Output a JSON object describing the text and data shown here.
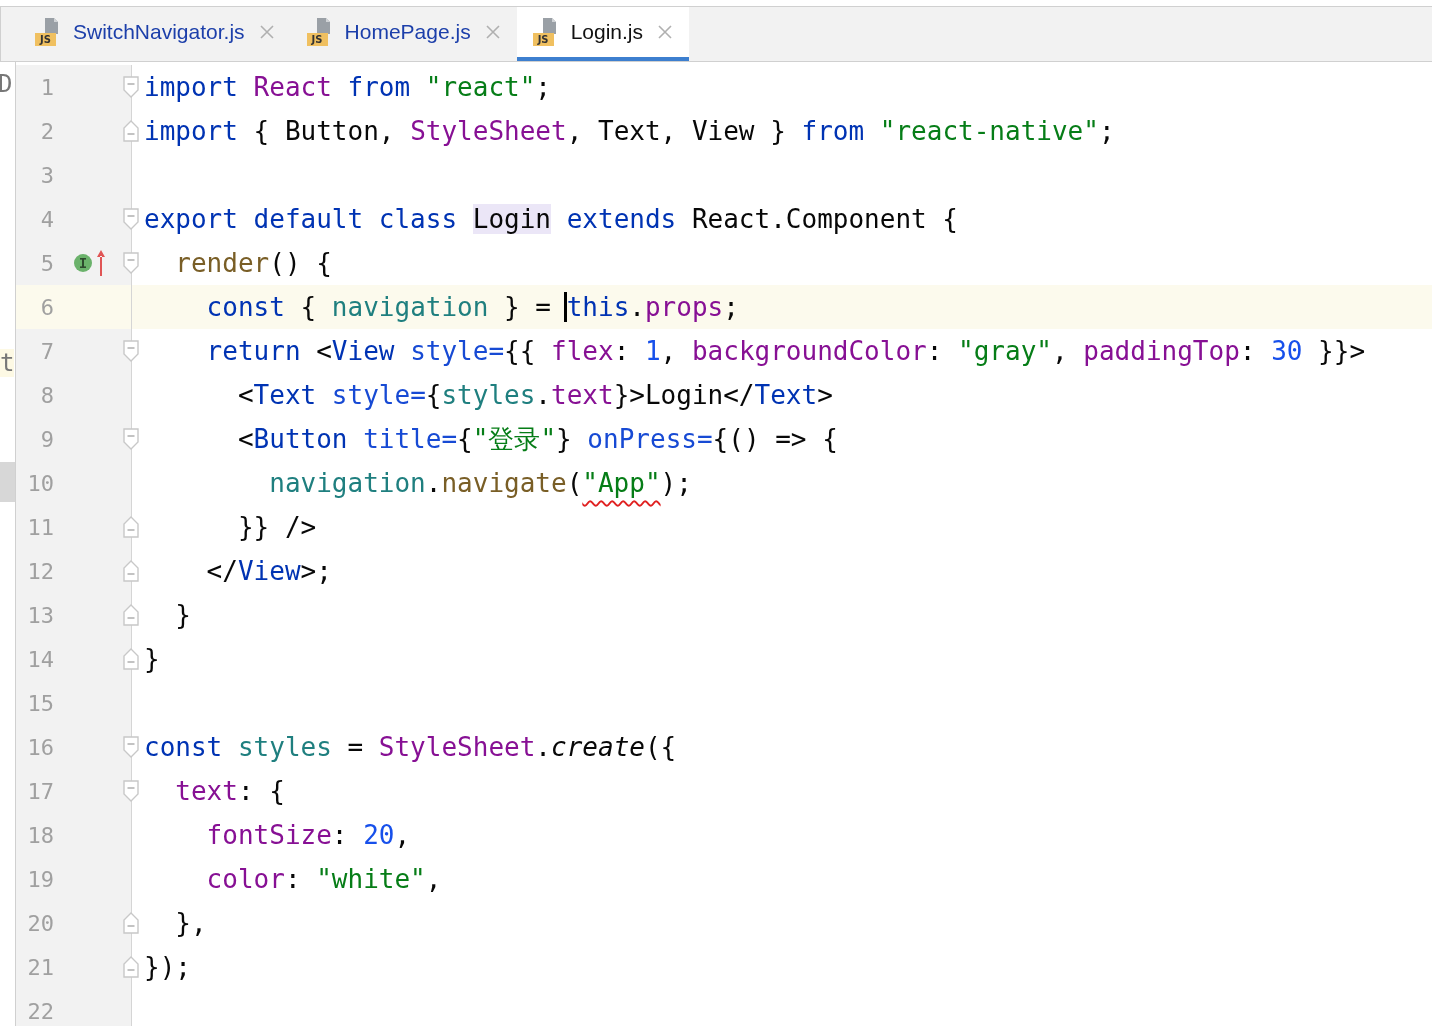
{
  "side_fragments": [
    {
      "text": "D"
    },
    {
      "text": "t"
    }
  ],
  "tabs": [
    {
      "label": "SwitchNavigator.js",
      "icon_text": "JS",
      "selected": false
    },
    {
      "label": "HomePage.js",
      "icon_text": "JS",
      "selected": false
    },
    {
      "label": "Login.js",
      "icon_text": "JS",
      "selected": true
    }
  ],
  "lines": [
    {
      "number": "1",
      "fold_open": true,
      "tokens": [
        {
          "text": "import ",
          "kind": "kw"
        },
        {
          "text": "React ",
          "kind": "cls"
        },
        {
          "text": "from ",
          "kind": "kw"
        },
        {
          "text": "\"react\"",
          "kind": "str"
        },
        {
          "text": ";",
          "kind": "p"
        }
      ]
    },
    {
      "number": "2",
      "fold_close": true,
      "tokens": [
        {
          "text": "import ",
          "kind": "kw"
        },
        {
          "text": "{ Button, ",
          "kind": "p"
        },
        {
          "text": "StyleSheet",
          "kind": "cls"
        },
        {
          "text": ", Text, View } ",
          "kind": "p"
        },
        {
          "text": "from ",
          "kind": "kw"
        },
        {
          "text": "\"react-native\"",
          "kind": "str"
        },
        {
          "text": ";",
          "kind": "p"
        }
      ]
    },
    {
      "number": "3"
    },
    {
      "number": "4",
      "fold_open": true,
      "tokens": [
        {
          "text": "export default class ",
          "kind": "kw"
        },
        {
          "text": "Login",
          "kind": "hl"
        },
        {
          "text": " extends ",
          "kind": "kw"
        },
        {
          "text": "React.Component {",
          "kind": "p"
        }
      ]
    },
    {
      "number": "5",
      "fold_open": true,
      "markers": [
        {
          "kind": "implements"
        },
        {
          "kind": "overrides"
        }
      ],
      "tokens": [
        {
          "text": "  render",
          "kind": "fn"
        },
        {
          "text": "() {",
          "kind": "p"
        }
      ]
    },
    {
      "number": "6",
      "current": true,
      "tokens": [
        {
          "text": "    const ",
          "kind": "kw"
        },
        {
          "text": "{ ",
          "kind": "p"
        },
        {
          "text": "navigation ",
          "kind": "var"
        },
        {
          "text": "} = ",
          "kind": "p"
        },
        {
          "text": "this",
          "kind": "kw",
          "caret": true
        },
        {
          "text": ".",
          "kind": "p"
        },
        {
          "text": "props",
          "kind": "prop"
        },
        {
          "text": ";",
          "kind": "p"
        }
      ]
    },
    {
      "number": "7",
      "fold_open": true,
      "tokens": [
        {
          "text": "    return ",
          "kind": "kw"
        },
        {
          "text": "<",
          "kind": "p"
        },
        {
          "text": "View ",
          "kind": "tag"
        },
        {
          "text": "style=",
          "kind": "attr"
        },
        {
          "text": "{{ ",
          "kind": "p"
        },
        {
          "text": "flex",
          "kind": "prop"
        },
        {
          "text": ": ",
          "kind": "p"
        },
        {
          "text": "1",
          "kind": "num"
        },
        {
          "text": ", ",
          "kind": "p"
        },
        {
          "text": "backgroundColor",
          "kind": "prop"
        },
        {
          "text": ": ",
          "kind": "p"
        },
        {
          "text": "\"gray\"",
          "kind": "str"
        },
        {
          "text": ", ",
          "kind": "p"
        },
        {
          "text": "paddingTop",
          "kind": "prop"
        },
        {
          "text": ": ",
          "kind": "p"
        },
        {
          "text": "30",
          "kind": "num"
        },
        {
          "text": " }}>",
          "kind": "p"
        }
      ]
    },
    {
      "number": "8",
      "tokens": [
        {
          "text": "      <",
          "kind": "p"
        },
        {
          "text": "Text ",
          "kind": "tag"
        },
        {
          "text": "style=",
          "kind": "attr"
        },
        {
          "text": "{",
          "kind": "p"
        },
        {
          "text": "styles",
          "kind": "var"
        },
        {
          "text": ".",
          "kind": "p"
        },
        {
          "text": "text",
          "kind": "prop"
        },
        {
          "text": "}>Login</",
          "kind": "p"
        },
        {
          "text": "Text",
          "kind": "tag"
        },
        {
          "text": ">",
          "kind": "p"
        }
      ]
    },
    {
      "number": "9",
      "fold_open": true,
      "tokens": [
        {
          "text": "      <",
          "kind": "p"
        },
        {
          "text": "Button ",
          "kind": "tag"
        },
        {
          "text": "title=",
          "kind": "attr"
        },
        {
          "text": "{",
          "kind": "p"
        },
        {
          "text": "\"登录\"",
          "kind": "str"
        },
        {
          "text": "} ",
          "kind": "p"
        },
        {
          "text": "onPress=",
          "kind": "attr"
        },
        {
          "text": "{() => {",
          "kind": "p"
        }
      ]
    },
    {
      "number": "10",
      "tokens": [
        {
          "text": "        navigation",
          "kind": "var"
        },
        {
          "text": ".",
          "kind": "p"
        },
        {
          "text": "navigate",
          "kind": "fn"
        },
        {
          "text": "(",
          "kind": "p"
        },
        {
          "text": "\"App\"",
          "kind": "str",
          "underline": true
        },
        {
          "text": ");",
          "kind": "p"
        }
      ]
    },
    {
      "number": "11",
      "fold_close": true,
      "tokens": [
        {
          "text": "      }} />",
          "kind": "p"
        }
      ]
    },
    {
      "number": "12",
      "fold_close": true,
      "tokens": [
        {
          "text": "    </",
          "kind": "p"
        },
        {
          "text": "View",
          "kind": "tag"
        },
        {
          "text": ">;",
          "kind": "p"
        }
      ]
    },
    {
      "number": "13",
      "fold_close": true,
      "tokens": [
        {
          "text": "  }",
          "kind": "p"
        }
      ]
    },
    {
      "number": "14",
      "fold_close": true,
      "tokens": [
        {
          "text": "}",
          "kind": "p"
        }
      ]
    },
    {
      "number": "15"
    },
    {
      "number": "16",
      "fold_open": true,
      "tokens": [
        {
          "text": "const ",
          "kind": "kw"
        },
        {
          "text": "styles ",
          "kind": "var"
        },
        {
          "text": "= ",
          "kind": "p"
        },
        {
          "text": "StyleSheet",
          "kind": "cls"
        },
        {
          "text": ".",
          "kind": "p"
        },
        {
          "text": "create",
          "kind": "it"
        },
        {
          "text": "({",
          "kind": "p"
        }
      ]
    },
    {
      "number": "17",
      "fold_open": true,
      "tokens": [
        {
          "text": "  text",
          "kind": "prop"
        },
        {
          "text": ": {",
          "kind": "p"
        }
      ]
    },
    {
      "number": "18",
      "tokens": [
        {
          "text": "    fontSize",
          "kind": "prop"
        },
        {
          "text": ": ",
          "kind": "p"
        },
        {
          "text": "20",
          "kind": "num"
        },
        {
          "text": ",",
          "kind": "p"
        }
      ]
    },
    {
      "number": "19",
      "tokens": [
        {
          "text": "    color",
          "kind": "prop"
        },
        {
          "text": ": ",
          "kind": "p"
        },
        {
          "text": "\"white\"",
          "kind": "str"
        },
        {
          "text": ",",
          "kind": "p"
        }
      ]
    },
    {
      "number": "20",
      "fold_close": true,
      "tokens": [
        {
          "text": "  },",
          "kind": "p"
        }
      ]
    },
    {
      "number": "21",
      "fold_close": true,
      "tokens": [
        {
          "text": "});",
          "kind": "p"
        }
      ]
    },
    {
      "number": "22"
    }
  ]
}
